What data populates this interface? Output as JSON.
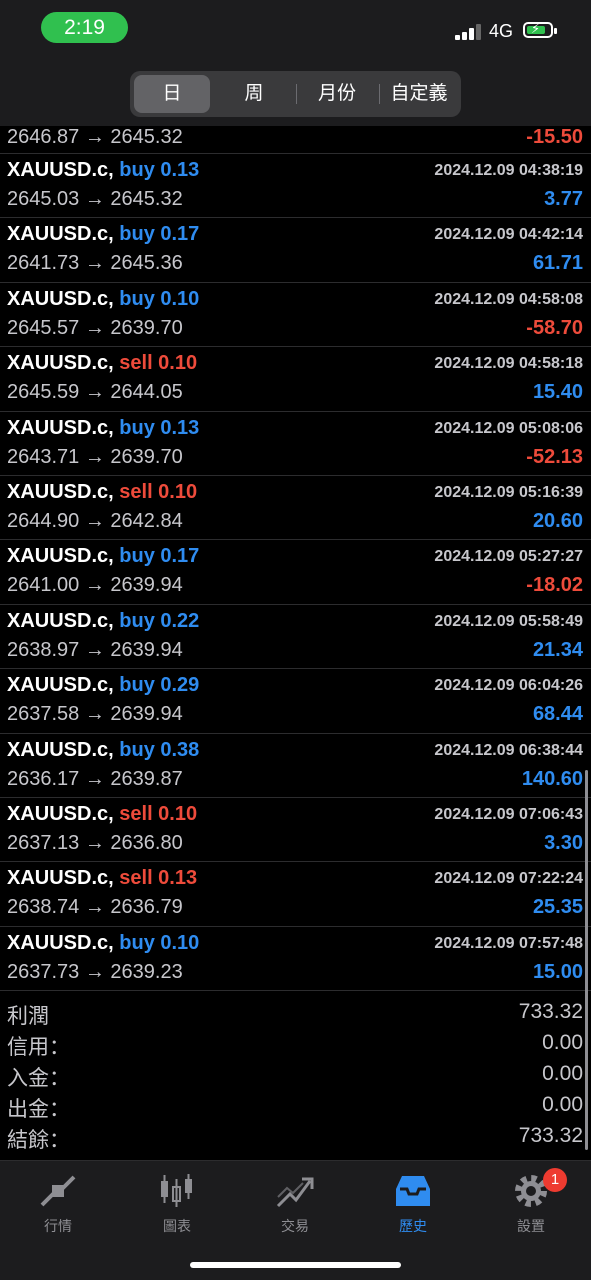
{
  "status_bar": {
    "time": "2:19",
    "network": "4G"
  },
  "period_tabs": [
    {
      "label": "日",
      "active": true
    },
    {
      "label": "周",
      "active": false
    },
    {
      "label": "月份",
      "active": false
    },
    {
      "label": "自定義",
      "active": false
    }
  ],
  "partial_row": {
    "price": "2646.87 → 2645.32",
    "profit": "-15.50",
    "profit_color": "red"
  },
  "trades": [
    {
      "symbol": "XAUUSD.c,",
      "side": "buy 0.13",
      "type": "buy",
      "time": "2024.12.09 04:38:19",
      "price": "2645.03 → 2645.32",
      "profit": "3.77",
      "profit_color": "blue"
    },
    {
      "symbol": "XAUUSD.c,",
      "side": "buy 0.17",
      "type": "buy",
      "time": "2024.12.09 04:42:14",
      "price": "2641.73 → 2645.36",
      "profit": "61.71",
      "profit_color": "blue"
    },
    {
      "symbol": "XAUUSD.c,",
      "side": "buy 0.10",
      "type": "buy",
      "time": "2024.12.09 04:58:08",
      "price": "2645.57 → 2639.70",
      "profit": "-58.70",
      "profit_color": "red"
    },
    {
      "symbol": "XAUUSD.c,",
      "side": "sell 0.10",
      "type": "sell",
      "time": "2024.12.09 04:58:18",
      "price": "2645.59 → 2644.05",
      "profit": "15.40",
      "profit_color": "blue"
    },
    {
      "symbol": "XAUUSD.c,",
      "side": "buy 0.13",
      "type": "buy",
      "time": "2024.12.09 05:08:06",
      "price": "2643.71 → 2639.70",
      "profit": "-52.13",
      "profit_color": "red"
    },
    {
      "symbol": "XAUUSD.c,",
      "side": "sell 0.10",
      "type": "sell",
      "time": "2024.12.09 05:16:39",
      "price": "2644.90 → 2642.84",
      "profit": "20.60",
      "profit_color": "blue"
    },
    {
      "symbol": "XAUUSD.c,",
      "side": "buy 0.17",
      "type": "buy",
      "time": "2024.12.09 05:27:27",
      "price": "2641.00 → 2639.94",
      "profit": "-18.02",
      "profit_color": "red"
    },
    {
      "symbol": "XAUUSD.c,",
      "side": "buy 0.22",
      "type": "buy",
      "time": "2024.12.09 05:58:49",
      "price": "2638.97 → 2639.94",
      "profit": "21.34",
      "profit_color": "blue"
    },
    {
      "symbol": "XAUUSD.c,",
      "side": "buy 0.29",
      "type": "buy",
      "time": "2024.12.09 06:04:26",
      "price": "2637.58 → 2639.94",
      "profit": "68.44",
      "profit_color": "blue"
    },
    {
      "symbol": "XAUUSD.c,",
      "side": "buy 0.38",
      "type": "buy",
      "time": "2024.12.09 06:38:44",
      "price": "2636.17 → 2639.87",
      "profit": "140.60",
      "profit_color": "blue"
    },
    {
      "symbol": "XAUUSD.c,",
      "side": "sell 0.10",
      "type": "sell",
      "time": "2024.12.09 07:06:43",
      "price": "2637.13 → 2636.80",
      "profit": "3.30",
      "profit_color": "blue"
    },
    {
      "symbol": "XAUUSD.c,",
      "side": "sell 0.13",
      "type": "sell",
      "time": "2024.12.09 07:22:24",
      "price": "2638.74 → 2636.79",
      "profit": "25.35",
      "profit_color": "blue"
    },
    {
      "symbol": "XAUUSD.c,",
      "side": "buy 0.10",
      "type": "buy",
      "time": "2024.12.09 07:57:48",
      "price": "2637.73 → 2639.23",
      "profit": "15.00",
      "profit_color": "blue"
    }
  ],
  "summary": [
    {
      "label": "利潤",
      "value": "733.32"
    },
    {
      "label": "信用：",
      "value": "0.00"
    },
    {
      "label": "入金：",
      "value": "0.00"
    },
    {
      "label": "出金：",
      "value": "0.00"
    },
    {
      "label": "結餘：",
      "value": "733.32"
    }
  ],
  "tabbar": [
    {
      "label": "行情",
      "icon": "quotes-arrows-icon",
      "active": false
    },
    {
      "label": "圖表",
      "icon": "candlestick-chart-icon",
      "active": false
    },
    {
      "label": "交易",
      "icon": "trade-trend-icon",
      "active": false
    },
    {
      "label": "歷史",
      "icon": "history-inbox-icon",
      "active": true
    },
    {
      "label": "設置",
      "icon": "gear-icon",
      "active": false,
      "badge": "1"
    }
  ],
  "colors": {
    "buy": "#2f8cf0",
    "sell": "#ee4b3b",
    "background": "#000000",
    "tabbar": "#1c1c1e"
  }
}
